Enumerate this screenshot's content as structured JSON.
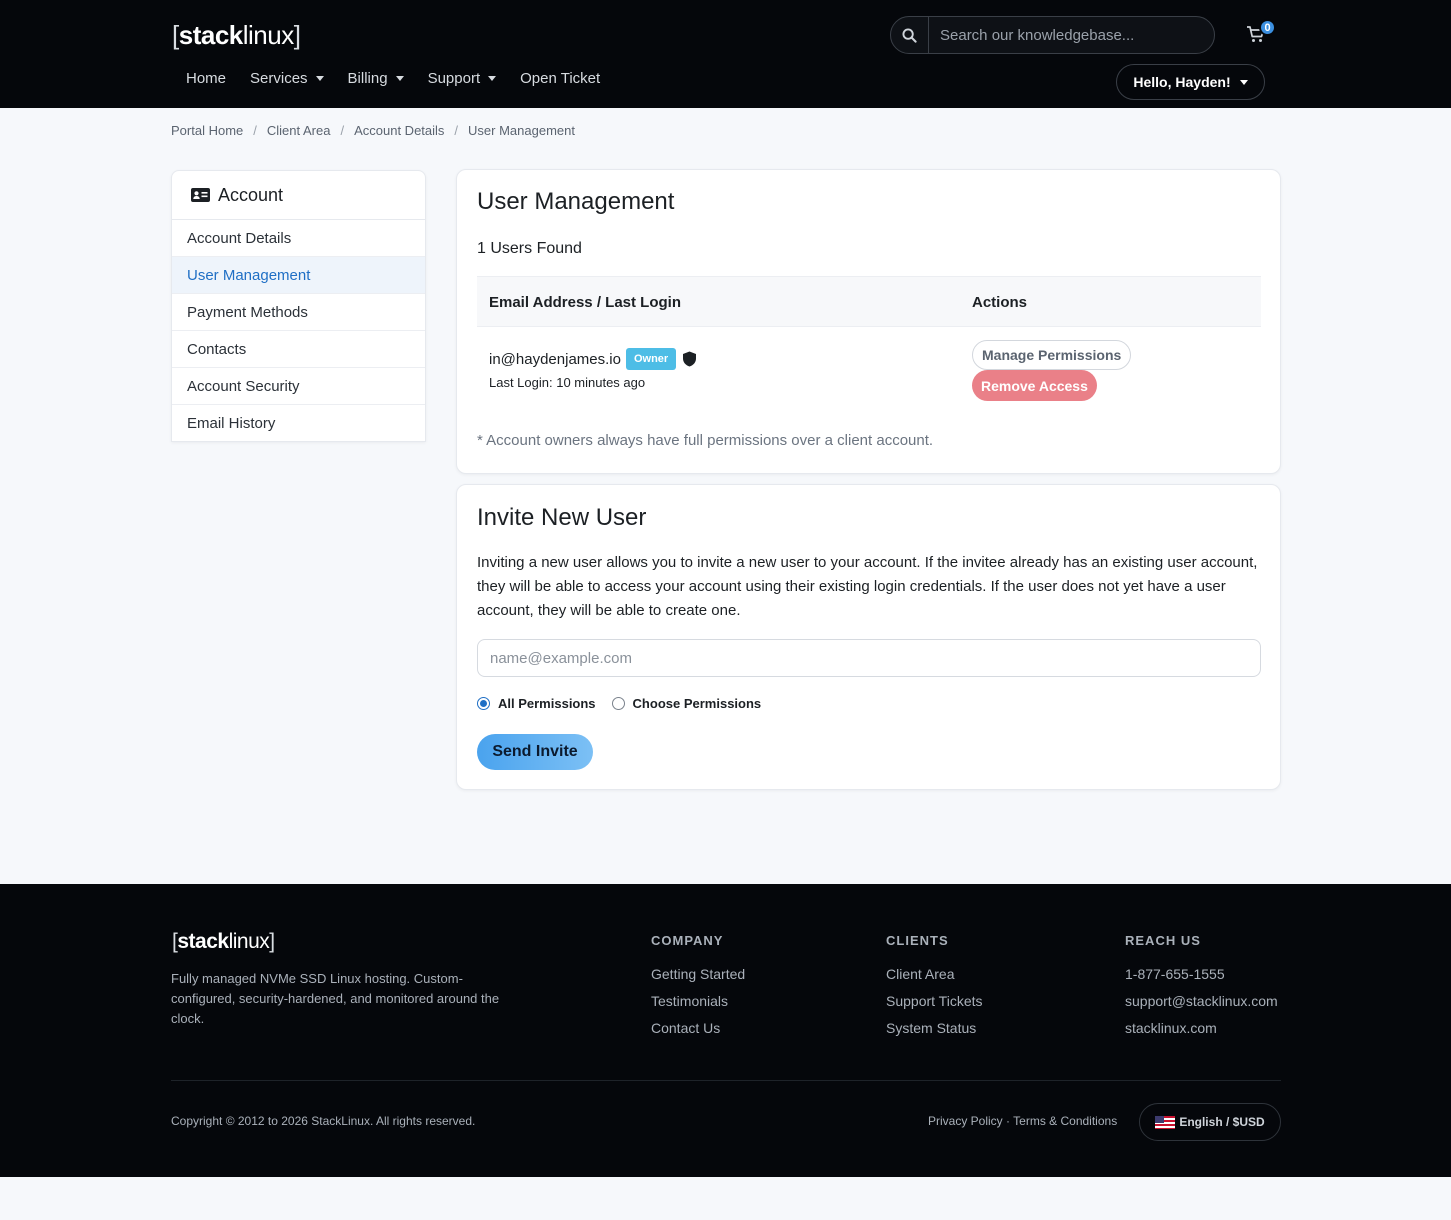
{
  "brand": {
    "bracket_open": "[",
    "bold": "stack",
    "light": "linux",
    "bracket_close": "]"
  },
  "header": {
    "search_placeholder": "Search our knowledgebase...",
    "cart_count": "0",
    "nav": [
      {
        "label": "Home",
        "dropdown": false
      },
      {
        "label": "Services",
        "dropdown": true
      },
      {
        "label": "Billing",
        "dropdown": true
      },
      {
        "label": "Support",
        "dropdown": true
      },
      {
        "label": "Open Ticket",
        "dropdown": false
      }
    ],
    "user_menu": "Hello, Hayden!"
  },
  "breadcrumb": [
    "Portal Home",
    "Client Area",
    "Account Details",
    "User Management"
  ],
  "sidebar": {
    "title": "Account",
    "items": [
      {
        "label": "Account Details",
        "active": false
      },
      {
        "label": "User Management",
        "active": true
      },
      {
        "label": "Payment Methods",
        "active": false
      },
      {
        "label": "Contacts",
        "active": false
      },
      {
        "label": "Account Security",
        "active": false
      },
      {
        "label": "Email History",
        "active": false
      }
    ]
  },
  "users": {
    "title": "User Management",
    "count_text": "1 Users Found",
    "columns": [
      "Email Address / Last Login",
      "Actions"
    ],
    "rows": [
      {
        "email": "in@haydenjames.io",
        "badge": "Owner",
        "last_login": "Last Login: 10 minutes ago",
        "manage_label": "Manage Permissions",
        "remove_label": "Remove Access"
      }
    ],
    "note": "* Account owners always have full permissions over a client account."
  },
  "invite": {
    "title": "Invite New User",
    "description": "Inviting a new user allows you to invite a new user to your account. If the invitee already has an existing user account, they will be able to access your account using their existing login credentials. If the user does not yet have a user account, they will be able to create one.",
    "email_placeholder": "name@example.com",
    "email_value": "",
    "perm_all": "All Permissions",
    "perm_choose": "Choose Permissions",
    "selected": "all",
    "send_label": "Send Invite"
  },
  "footer": {
    "tagline": "Fully managed NVMe SSD Linux hosting. Custom-configured, security-hardened, and monitored around the clock.",
    "company": {
      "heading": "COMPANY",
      "links": [
        "Getting Started",
        "Testimonials",
        "Contact Us"
      ]
    },
    "clients": {
      "heading": "CLIENTS",
      "links": [
        "Client Area",
        "Support Tickets",
        "System Status"
      ]
    },
    "reach": {
      "heading": "REACH US",
      "links": [
        "1-877-655-1555",
        "support@stacklinux.com",
        "stacklinux.com"
      ]
    },
    "copyright": "Copyright © 2012 to 2026 StackLinux. All rights reserved.",
    "privacy": "Privacy Policy",
    "legal_sep": "·",
    "terms": "Terms & Conditions",
    "language": "English / $USD"
  },
  "colors": {
    "accent": "#3b8fe0",
    "owner_badge": "#4dbde6",
    "danger": "#ea8088",
    "header_bg": "#05070b"
  }
}
